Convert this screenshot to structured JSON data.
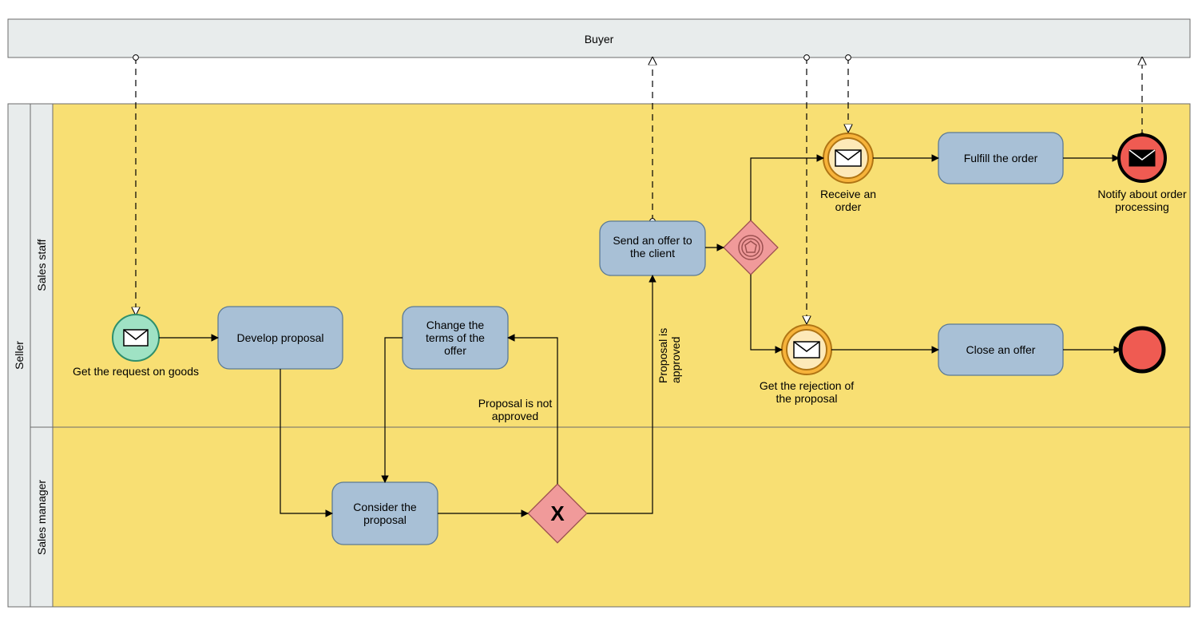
{
  "pools": {
    "buyer": "Buyer",
    "seller": "Seller"
  },
  "lanes": {
    "sales_staff": "Sales staff",
    "sales_manager": "Sales manager"
  },
  "events": {
    "get_request": "Get the request on goods",
    "receive_order": "Receive an order",
    "get_rejection_l1": "Get the rejection of",
    "get_rejection_l2": "the proposal",
    "notify_l1": "Notify about order",
    "notify_l2": "processing"
  },
  "tasks": {
    "develop": "Develop proposal",
    "change_l1": "Change the",
    "change_l2": "terms of the",
    "change_l3": "offer",
    "consider_l1": "Consider the",
    "consider_l2": "proposal",
    "send_l1": "Send an offer to",
    "send_l2": "the client",
    "fulfill": "Fulfill the order",
    "close": "Close an offer"
  },
  "labels": {
    "not_approved_l1": "Proposal is not",
    "not_approved_l2": "approved",
    "approved_l1": "Proposal is",
    "approved_l2": "approved"
  },
  "chart_data": {
    "type": "bpmn",
    "pools": [
      {
        "id": "buyer",
        "name": "Buyer",
        "external": true
      },
      {
        "id": "seller",
        "name": "Seller",
        "lanes": [
          {
            "id": "sales_staff",
            "name": "Sales staff"
          },
          {
            "id": "sales_manager",
            "name": "Sales manager"
          }
        ]
      }
    ],
    "nodes": [
      {
        "id": "start",
        "type": "startEvent",
        "subtype": "message",
        "lane": "sales_staff",
        "label": "Get the request on goods"
      },
      {
        "id": "develop",
        "type": "task",
        "lane": "sales_staff",
        "label": "Develop proposal"
      },
      {
        "id": "consider",
        "type": "task",
        "lane": "sales_manager",
        "label": "Consider the proposal"
      },
      {
        "id": "gwX",
        "type": "exclusiveGateway",
        "lane": "sales_manager"
      },
      {
        "id": "change",
        "type": "task",
        "lane": "sales_staff",
        "label": "Change the terms of the offer"
      },
      {
        "id": "send",
        "type": "task",
        "lane": "sales_staff",
        "label": "Send an offer to the client"
      },
      {
        "id": "gwEv",
        "type": "eventBasedGateway",
        "lane": "sales_staff"
      },
      {
        "id": "recvOrder",
        "type": "intermediateCatchEvent",
        "subtype": "message",
        "lane": "sales_staff",
        "label": "Receive an order"
      },
      {
        "id": "recvReject",
        "type": "intermediateCatchEvent",
        "subtype": "message",
        "lane": "sales_staff",
        "label": "Get the rejection of the proposal"
      },
      {
        "id": "fulfill",
        "type": "task",
        "lane": "sales_staff",
        "label": "Fulfill the order"
      },
      {
        "id": "close",
        "type": "task",
        "lane": "sales_staff",
        "label": "Close an offer"
      },
      {
        "id": "endMsg",
        "type": "endEvent",
        "subtype": "message",
        "lane": "sales_staff",
        "label": "Notify about order processing"
      },
      {
        "id": "end",
        "type": "endEvent",
        "lane": "sales_staff"
      }
    ],
    "sequenceFlows": [
      {
        "from": "start",
        "to": "develop"
      },
      {
        "from": "develop",
        "to": "consider"
      },
      {
        "from": "consider",
        "to": "gwX"
      },
      {
        "from": "gwX",
        "to": "change",
        "label": "Proposal is not approved"
      },
      {
        "from": "change",
        "to": "consider"
      },
      {
        "from": "gwX",
        "to": "send",
        "label": "Proposal is approved"
      },
      {
        "from": "send",
        "to": "gwEv"
      },
      {
        "from": "gwEv",
        "to": "recvOrder"
      },
      {
        "from": "gwEv",
        "to": "recvReject"
      },
      {
        "from": "recvOrder",
        "to": "fulfill"
      },
      {
        "from": "fulfill",
        "to": "endMsg"
      },
      {
        "from": "recvReject",
        "to": "close"
      },
      {
        "from": "close",
        "to": "end"
      }
    ],
    "messageFlows": [
      {
        "from": "buyer",
        "to": "start"
      },
      {
        "from": "send",
        "to": "buyer"
      },
      {
        "from": "buyer",
        "to": "recvOrder"
      },
      {
        "from": "buyer",
        "to": "recvReject"
      },
      {
        "from": "endMsg",
        "to": "buyer"
      }
    ]
  }
}
